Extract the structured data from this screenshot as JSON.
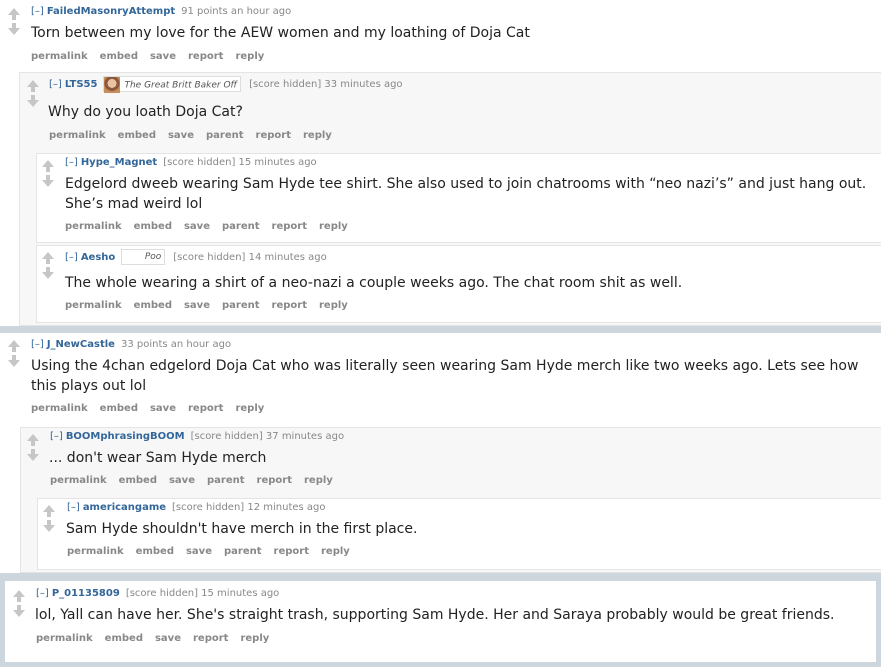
{
  "comments": {
    "c1": {
      "expand": "[–]",
      "author": "FailedMasonryAttempt",
      "score": "91 points an hour ago",
      "body": "Torn between my love for the AEW women and my loathing of Doja Cat",
      "buttons": [
        "permalink",
        "embed",
        "save",
        "report",
        "reply"
      ]
    },
    "c2": {
      "expand": "[–]",
      "author": "LTS55",
      "flair": "The Great Britt Baker Off",
      "score": "[score hidden] 33 minutes ago",
      "body": "Why do you loath Doja Cat?",
      "buttons": [
        "permalink",
        "embed",
        "save",
        "parent",
        "report",
        "reply"
      ]
    },
    "c3": {
      "expand": "[–]",
      "author": "Hype_Magnet",
      "score": "[score hidden] 15 minutes ago",
      "body_line1": "Edgelord dweeb wearing Sam Hyde tee shirt. She also used to join chatrooms with “neo nazi’s” and just hang out.",
      "body_line2": "She’s mad weird lol",
      "buttons": [
        "permalink",
        "embed",
        "save",
        "parent",
        "report",
        "reply"
      ]
    },
    "c4": {
      "expand": "[–]",
      "author": "Aesho",
      "flair": "Poo",
      "score": "[score hidden] 14 minutes ago",
      "body": "The whole wearing a shirt of a neo-nazi a couple weeks ago. The chat room shit as well.",
      "buttons": [
        "permalink",
        "embed",
        "save",
        "parent",
        "report",
        "reply"
      ]
    },
    "c5": {
      "expand": "[–]",
      "author": "J_NewCastle",
      "score": "33 points an hour ago",
      "body_line1": "Using the 4chan edgelord Doja Cat who was literally seen wearing Sam Hyde merch like two weeks ago. Lets see how",
      "body_line2": "this plays out lol",
      "buttons": [
        "permalink",
        "embed",
        "save",
        "report",
        "reply"
      ]
    },
    "c6": {
      "expand": "[–]",
      "author": "BOOMphrasingBOOM",
      "score": "[score hidden] 37 minutes ago",
      "body": "... don't wear Sam Hyde merch",
      "buttons": [
        "permalink",
        "embed",
        "save",
        "parent",
        "report",
        "reply"
      ]
    },
    "c7": {
      "expand": "[–]",
      "author": "americangame",
      "score": "[score hidden] 12 minutes ago",
      "body": "Sam Hyde shouldn't have merch in the first place.",
      "buttons": [
        "permalink",
        "embed",
        "save",
        "parent",
        "report",
        "reply"
      ]
    },
    "c8": {
      "expand": "[–]",
      "author": "P_01135809",
      "score": "[score hidden] 15 minutes ago",
      "body": "lol, Yall can have her. She's straight trash, supporting Sam Hyde. Her and Saraya probably would be great friends.",
      "buttons": [
        "permalink",
        "embed",
        "save",
        "report",
        "reply"
      ]
    }
  },
  "colors": {
    "link": "#336699",
    "meta": "#888888",
    "border": "#e4e4e4",
    "separator": "#cdd5dd",
    "arrow": "#c6c6c6"
  },
  "icons": {
    "upvote": "upvote-arrow-icon",
    "downvote": "downvote-arrow-icon"
  }
}
